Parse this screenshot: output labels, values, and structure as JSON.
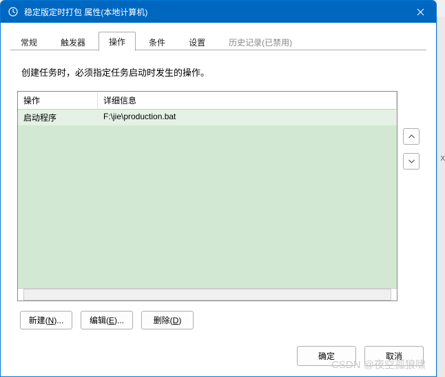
{
  "titlebar": {
    "title": "稳定版定时打包 属性(本地计算机)"
  },
  "tabs": {
    "items": [
      {
        "label": "常规"
      },
      {
        "label": "触发器"
      },
      {
        "label": "操作"
      },
      {
        "label": "条件"
      },
      {
        "label": "设置"
      },
      {
        "label": "历史记录(已禁用)"
      }
    ]
  },
  "instruction": "创建任务时，必须指定任务启动时发生的操作。",
  "list": {
    "headers": {
      "action": "操作",
      "detail": "详细信息"
    },
    "rows": [
      {
        "action": "启动程序",
        "detail": "F:\\jie\\production.bat"
      }
    ]
  },
  "actions": {
    "new_label": "新建(",
    "new_key": "N",
    "new_tail": ")...",
    "edit_label": "编辑(",
    "edit_key": "E",
    "edit_tail": ")...",
    "delete_label": "删除(",
    "delete_key": "D",
    "delete_tail": ")"
  },
  "footer": {
    "ok": "确定",
    "cancel": "取消"
  },
  "watermark": "CSDN @夜空孤狼啸",
  "edge_mark": "X"
}
